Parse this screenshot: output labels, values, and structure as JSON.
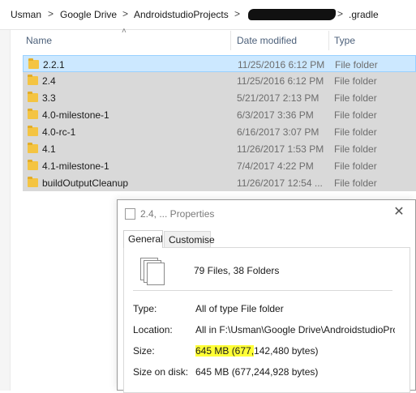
{
  "breadcrumb": {
    "items": [
      "Usman",
      "Google Drive",
      "AndroidstudioProjects",
      ".gradle"
    ],
    "separator": ">"
  },
  "columns": {
    "name": "Name",
    "date": "Date modified",
    "type": "Type"
  },
  "rows": [
    {
      "name": "2.2.1",
      "date": "11/25/2016 6:12 PM",
      "type": "File folder"
    },
    {
      "name": "2.4",
      "date": "11/25/2016 6:12 PM",
      "type": "File folder"
    },
    {
      "name": "3.3",
      "date": "5/21/2017 2:13 PM",
      "type": "File folder"
    },
    {
      "name": "4.0-milestone-1",
      "date": "6/3/2017 3:36 PM",
      "type": "File folder"
    },
    {
      "name": "4.0-rc-1",
      "date": "6/16/2017 3:07 PM",
      "type": "File folder"
    },
    {
      "name": "4.1",
      "date": "11/26/2017 1:53 PM",
      "type": "File folder"
    },
    {
      "name": "4.1-milestone-1",
      "date": "7/4/2017 4:22 PM",
      "type": "File folder"
    },
    {
      "name": "buildOutputCleanup",
      "date": "11/26/2017 12:54 ...",
      "type": "File folder"
    }
  ],
  "dialog": {
    "title": "2.4, ... Properties",
    "close_glyph": "✕",
    "tabs": [
      "General",
      "Customise"
    ],
    "summary": "79 Files, 38 Folders",
    "fields": {
      "type_label": "Type:",
      "type_value": "All of type File folder",
      "location_label": "Location:",
      "location_value": "All in F:\\Usman\\Google Drive\\AndroidstudioProjects",
      "size_label": "Size:",
      "size_value_highlight": "645 MB (677,",
      "size_value_rest": "142,480 bytes)",
      "size_on_disk_label": "Size on disk:",
      "size_on_disk_value": "645 MB (677,244,928 bytes)"
    }
  },
  "colors": {
    "selection": "#cce8ff",
    "dim_selection": "#d9d9d9",
    "folder": "#f4c442",
    "highlight": "#ffff36",
    "header_text": "#4c607a"
  }
}
